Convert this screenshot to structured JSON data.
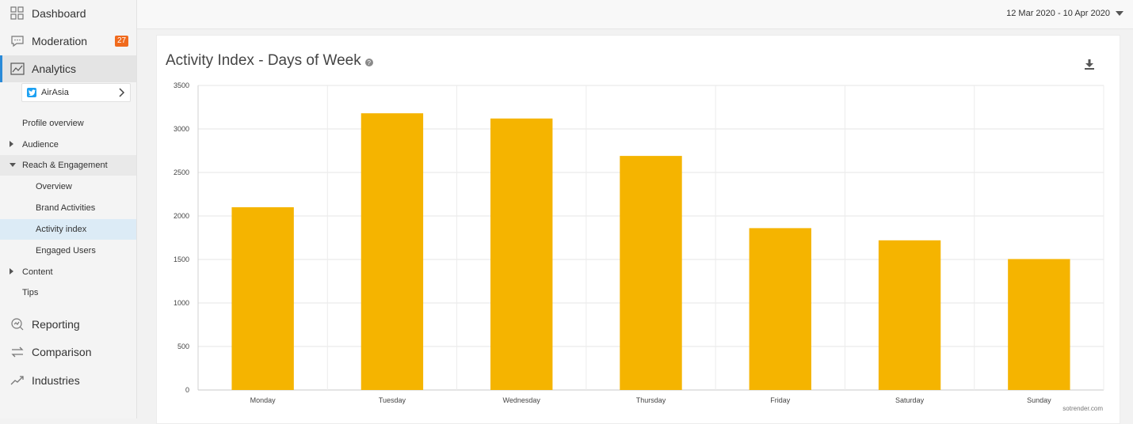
{
  "sidebar": {
    "main_items": [
      {
        "label": "Dashboard",
        "icon": "dashboard-icon"
      },
      {
        "label": "Moderation",
        "icon": "moderation-icon",
        "badge": "27"
      },
      {
        "label": "Analytics",
        "icon": "analytics-icon",
        "active": true
      }
    ],
    "profile": {
      "name": "AirAsia",
      "network_icon": "twitter-icon"
    },
    "analytics_menu": [
      {
        "label": "Profile overview"
      },
      {
        "label": "Audience"
      },
      {
        "label": "Reach & Engagement"
      },
      {
        "label": "Overview"
      },
      {
        "label": "Brand Activities"
      },
      {
        "label": "Activity index"
      },
      {
        "label": "Engaged Users"
      },
      {
        "label": "Content"
      },
      {
        "label": "Tips"
      }
    ],
    "bottom_items": [
      {
        "label": "Reporting",
        "icon": "reporting-icon"
      },
      {
        "label": "Comparison",
        "icon": "comparison-icon"
      },
      {
        "label": "Industries",
        "icon": "industries-icon"
      }
    ]
  },
  "topbar": {
    "date_range": "12 Mar 2020 - 10 Apr 2020"
  },
  "panel": {
    "title": "Activity Index - Days of Week",
    "credit": "sotrender.com"
  },
  "colors": {
    "bar": "#f5b400",
    "accent": "#2a8ad8",
    "badge": "#f06a1d"
  },
  "chart_data": {
    "type": "bar",
    "title": "Activity Index - Days of Week",
    "categories": [
      "Monday",
      "Tuesday",
      "Wednesday",
      "Thursday",
      "Friday",
      "Saturday",
      "Sunday"
    ],
    "values": [
      2100,
      3180,
      3120,
      2690,
      1860,
      1720,
      1505
    ],
    "yticks": [
      "0",
      "500",
      "1000",
      "1500",
      "2000",
      "2500",
      "3000",
      "3500"
    ],
    "ylim": [
      0,
      3500
    ],
    "grid": true,
    "legend": "none"
  }
}
